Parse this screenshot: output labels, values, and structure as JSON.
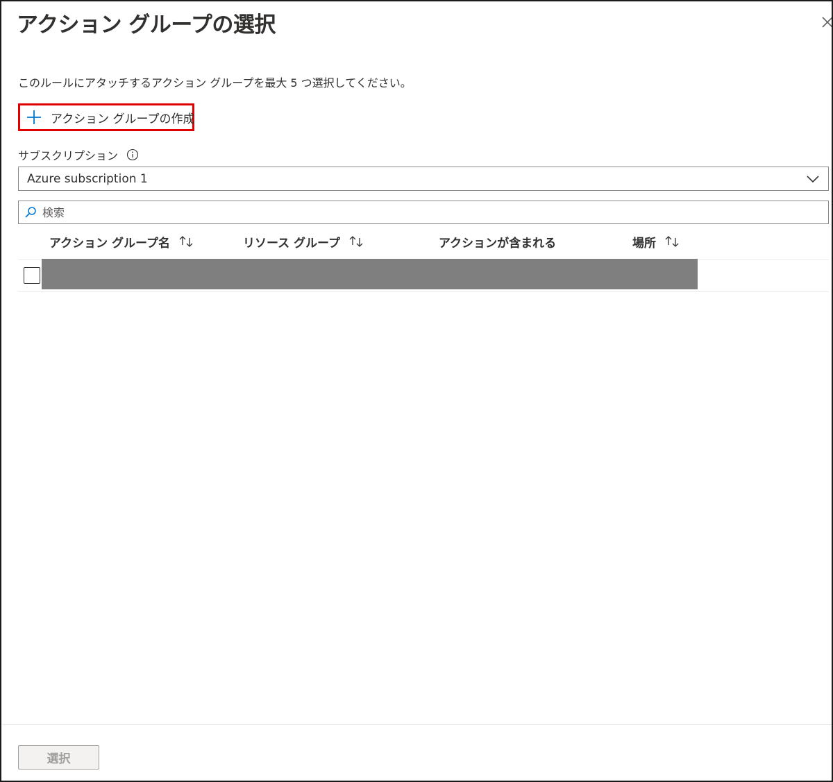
{
  "header": {
    "title": "アクション グループの選択"
  },
  "description": "このルールにアタッチするアクション グループを最大 5 つ選択してください。",
  "create_button": {
    "label": "アクション グループの作成"
  },
  "subscription": {
    "label": "サブスクリプション",
    "selected": "Azure subscription 1"
  },
  "search": {
    "placeholder": "検索"
  },
  "table": {
    "columns": [
      {
        "label": "アクション グループ名",
        "sortable": true
      },
      {
        "label": "リソース グループ",
        "sortable": true
      },
      {
        "label": "アクションが含まれる",
        "sortable": false
      },
      {
        "label": "場所",
        "sortable": true
      }
    ],
    "rows": [
      {
        "checked": false,
        "redacted": true
      }
    ]
  },
  "footer": {
    "select_label": "選択",
    "select_disabled": true
  },
  "colors": {
    "highlight_border": "#e00000",
    "accent": "#0078d4",
    "text": "#323130",
    "redaction": "#7f7f7f"
  }
}
